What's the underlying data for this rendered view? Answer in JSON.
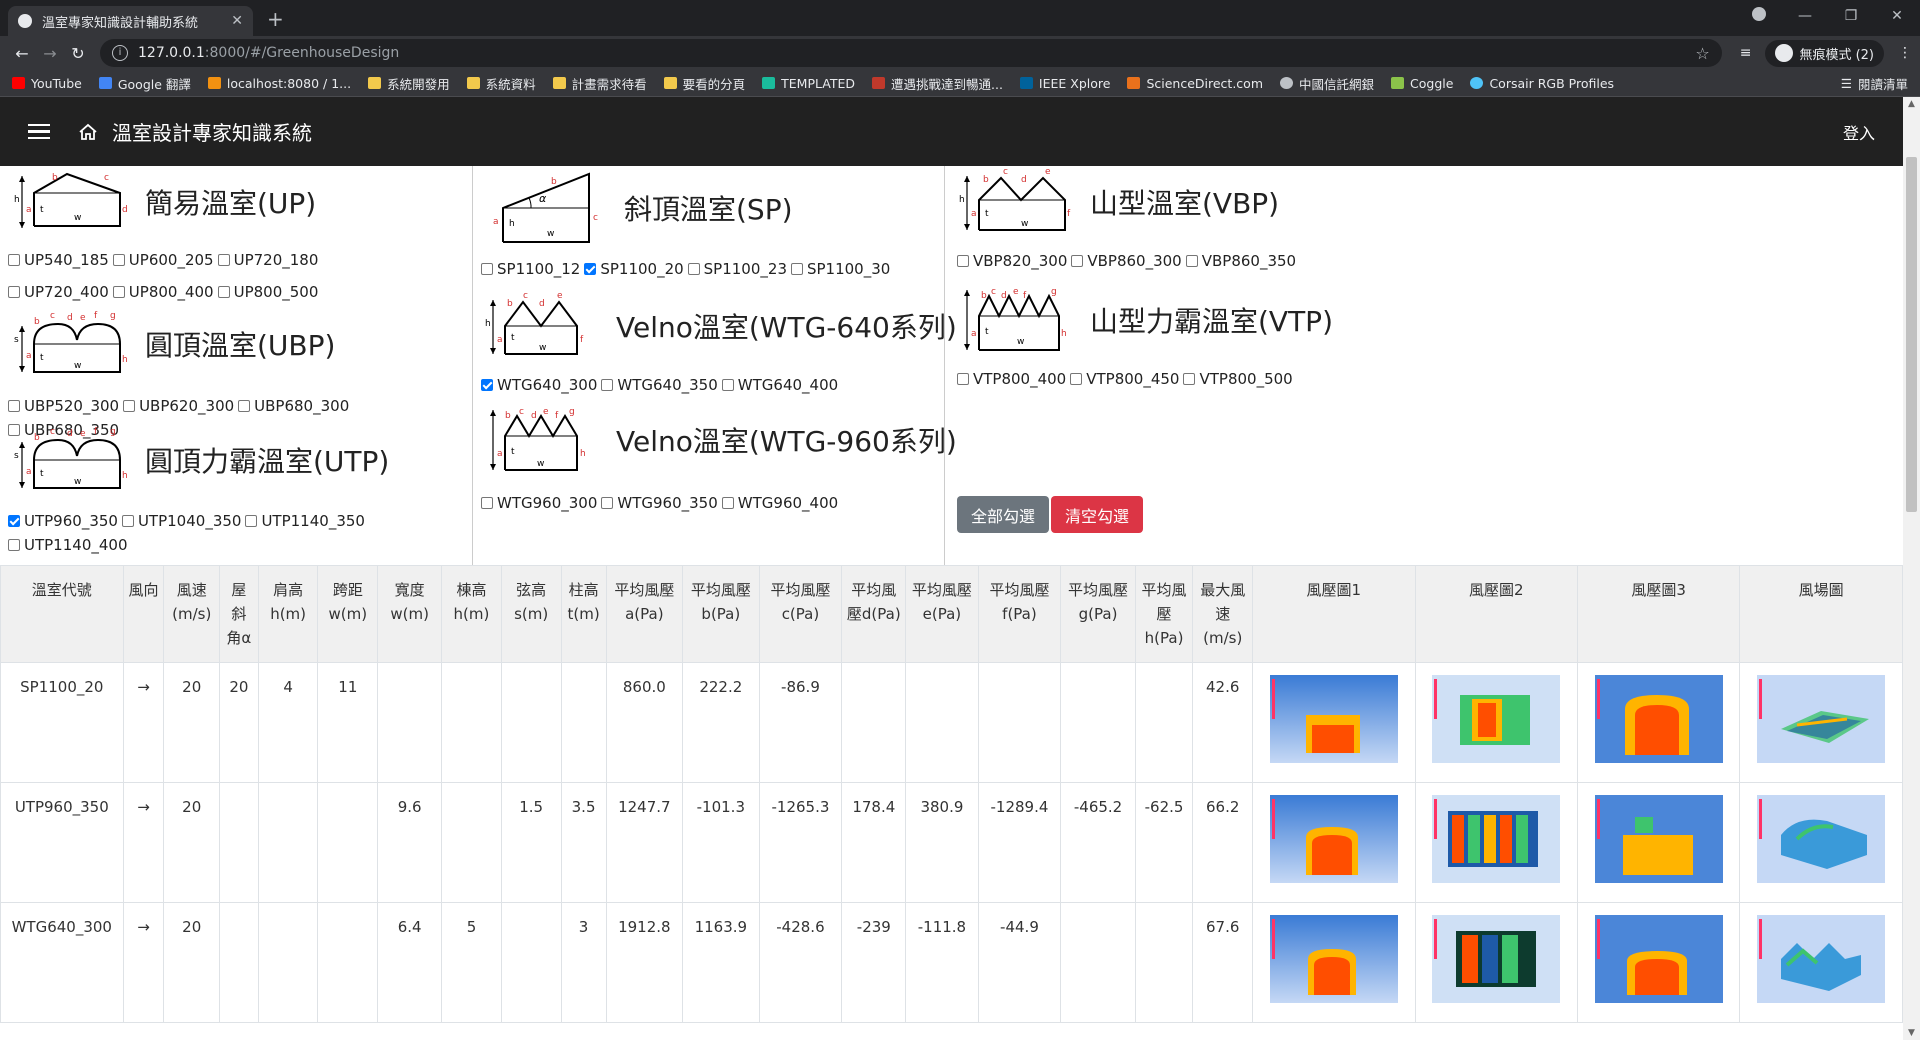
{
  "browser": {
    "tab_title": "溫室專家知識設計輔助系統",
    "url_host": "127.0.0.1",
    "url_rest": ":8000/#/GreenhouseDesign",
    "incognito_label": "無痕模式 (2)",
    "reading_list": "閱讀清單",
    "bookmarks": [
      "YouTube",
      "Google 翻譯",
      "localhost:8080 / 1...",
      "系統開發用",
      "系統資料",
      "計畫需求待看",
      "要看的分頁",
      "TEMPLATED",
      "遭遇挑戰達到暢通...",
      "IEEE Xplore",
      "ScienceDirect.com",
      "中國信託網銀",
      "Coggle",
      "Corsair RGB Profiles"
    ]
  },
  "app": {
    "title": "溫室設計專家知識系統",
    "login": "登入"
  },
  "types": {
    "up": {
      "name": "簡易溫室(UP)",
      "options": [
        {
          "label": "UP540_185",
          "checked": false
        },
        {
          "label": "UP600_205",
          "checked": false
        },
        {
          "label": "UP720_180",
          "checked": false
        },
        {
          "label": "UP720_400",
          "checked": false
        },
        {
          "label": "UP800_400",
          "checked": false
        },
        {
          "label": "UP800_500",
          "checked": false
        }
      ]
    },
    "ubp": {
      "name": "圓頂溫室(UBP)",
      "options": [
        {
          "label": "UBP520_300",
          "checked": false
        },
        {
          "label": "UBP620_300",
          "checked": false
        },
        {
          "label": "UBP680_300",
          "checked": false
        },
        {
          "label": "UBP680_350",
          "checked": false
        }
      ]
    },
    "utp": {
      "name": "圓頂力霸溫室(UTP)",
      "options": [
        {
          "label": "UTP960_350",
          "checked": true
        },
        {
          "label": "UTP1040_350",
          "checked": false
        },
        {
          "label": "UTP1140_350",
          "checked": false
        },
        {
          "label": "UTP1140_400",
          "checked": false
        }
      ]
    },
    "sp": {
      "name": "斜頂溫室(SP)",
      "options": [
        {
          "label": "SP1100_12",
          "checked": false
        },
        {
          "label": "SP1100_20",
          "checked": true
        },
        {
          "label": "SP1100_23",
          "checked": false
        },
        {
          "label": "SP1100_30",
          "checked": false
        }
      ]
    },
    "wtg640": {
      "name": "Velno溫室(WTG-640系列)",
      "options": [
        {
          "label": "WTG640_300",
          "checked": true
        },
        {
          "label": "WTG640_350",
          "checked": false
        },
        {
          "label": "WTG640_400",
          "checked": false
        }
      ]
    },
    "wtg960": {
      "name": "Velno溫室(WTG-960系列)",
      "options": [
        {
          "label": "WTG960_300",
          "checked": false
        },
        {
          "label": "WTG960_350",
          "checked": false
        },
        {
          "label": "WTG960_400",
          "checked": false
        }
      ]
    },
    "vbp": {
      "name": "山型溫室(VBP)",
      "options": [
        {
          "label": "VBP820_300",
          "checked": false
        },
        {
          "label": "VBP860_300",
          "checked": false
        },
        {
          "label": "VBP860_350",
          "checked": false
        }
      ]
    },
    "vtp": {
      "name": "山型力霸溫室(VTP)",
      "options": [
        {
          "label": "VTP800_400",
          "checked": false
        },
        {
          "label": "VTP800_450",
          "checked": false
        },
        {
          "label": "VTP800_500",
          "checked": false
        }
      ]
    }
  },
  "buttons": {
    "select_all": "全部勾選",
    "clear": "清空勾選"
  },
  "table": {
    "headers": [
      "溫室代號",
      "風向",
      "風速(m/s)",
      "屋斜角α",
      "肩高h(m)",
      "跨距w(m)",
      "寬度w(m)",
      "棟高h(m)",
      "弦高s(m)",
      "柱高t(m)",
      "平均風壓a(Pa)",
      "平均風壓b(Pa)",
      "平均風壓c(Pa)",
      "平均風壓d(Pa)",
      "平均風壓e(Pa)",
      "平均風壓f(Pa)",
      "平均風壓g(Pa)",
      "平均風壓h(Pa)",
      "最大風速(m/s)",
      "風壓圖1",
      "風壓圖2",
      "風壓圖3",
      "風場圖"
    ],
    "rows": [
      [
        "SP1100_20",
        "→",
        "20",
        "20",
        "4",
        "11",
        "",
        "",
        "",
        "",
        "860.0",
        "222.2",
        "-86.9",
        "",
        "",
        "",
        "",
        "",
        "42.6"
      ],
      [
        "UTP960_350",
        "→",
        "20",
        "",
        "",
        "",
        "9.6",
        "",
        "1.5",
        "3.5",
        "1247.7",
        "-101.3",
        "-1265.3",
        "178.4",
        "380.9",
        "-1289.4",
        "-465.2",
        "-62.5",
        "66.2"
      ],
      [
        "WTG640_300",
        "→",
        "20",
        "",
        "",
        "",
        "6.4",
        "5",
        "",
        "3",
        "1912.8",
        "1163.9",
        "-428.6",
        "-239",
        "-111.8",
        "-44.9",
        "",
        "",
        "67.6"
      ]
    ]
  },
  "figure_labels": {
    "a": "a",
    "b": "b",
    "c": "c",
    "d": "d",
    "e": "e",
    "f": "f",
    "g": "g",
    "h": "h",
    "s": "s",
    "t": "t",
    "w": "w",
    "alpha": "α"
  }
}
